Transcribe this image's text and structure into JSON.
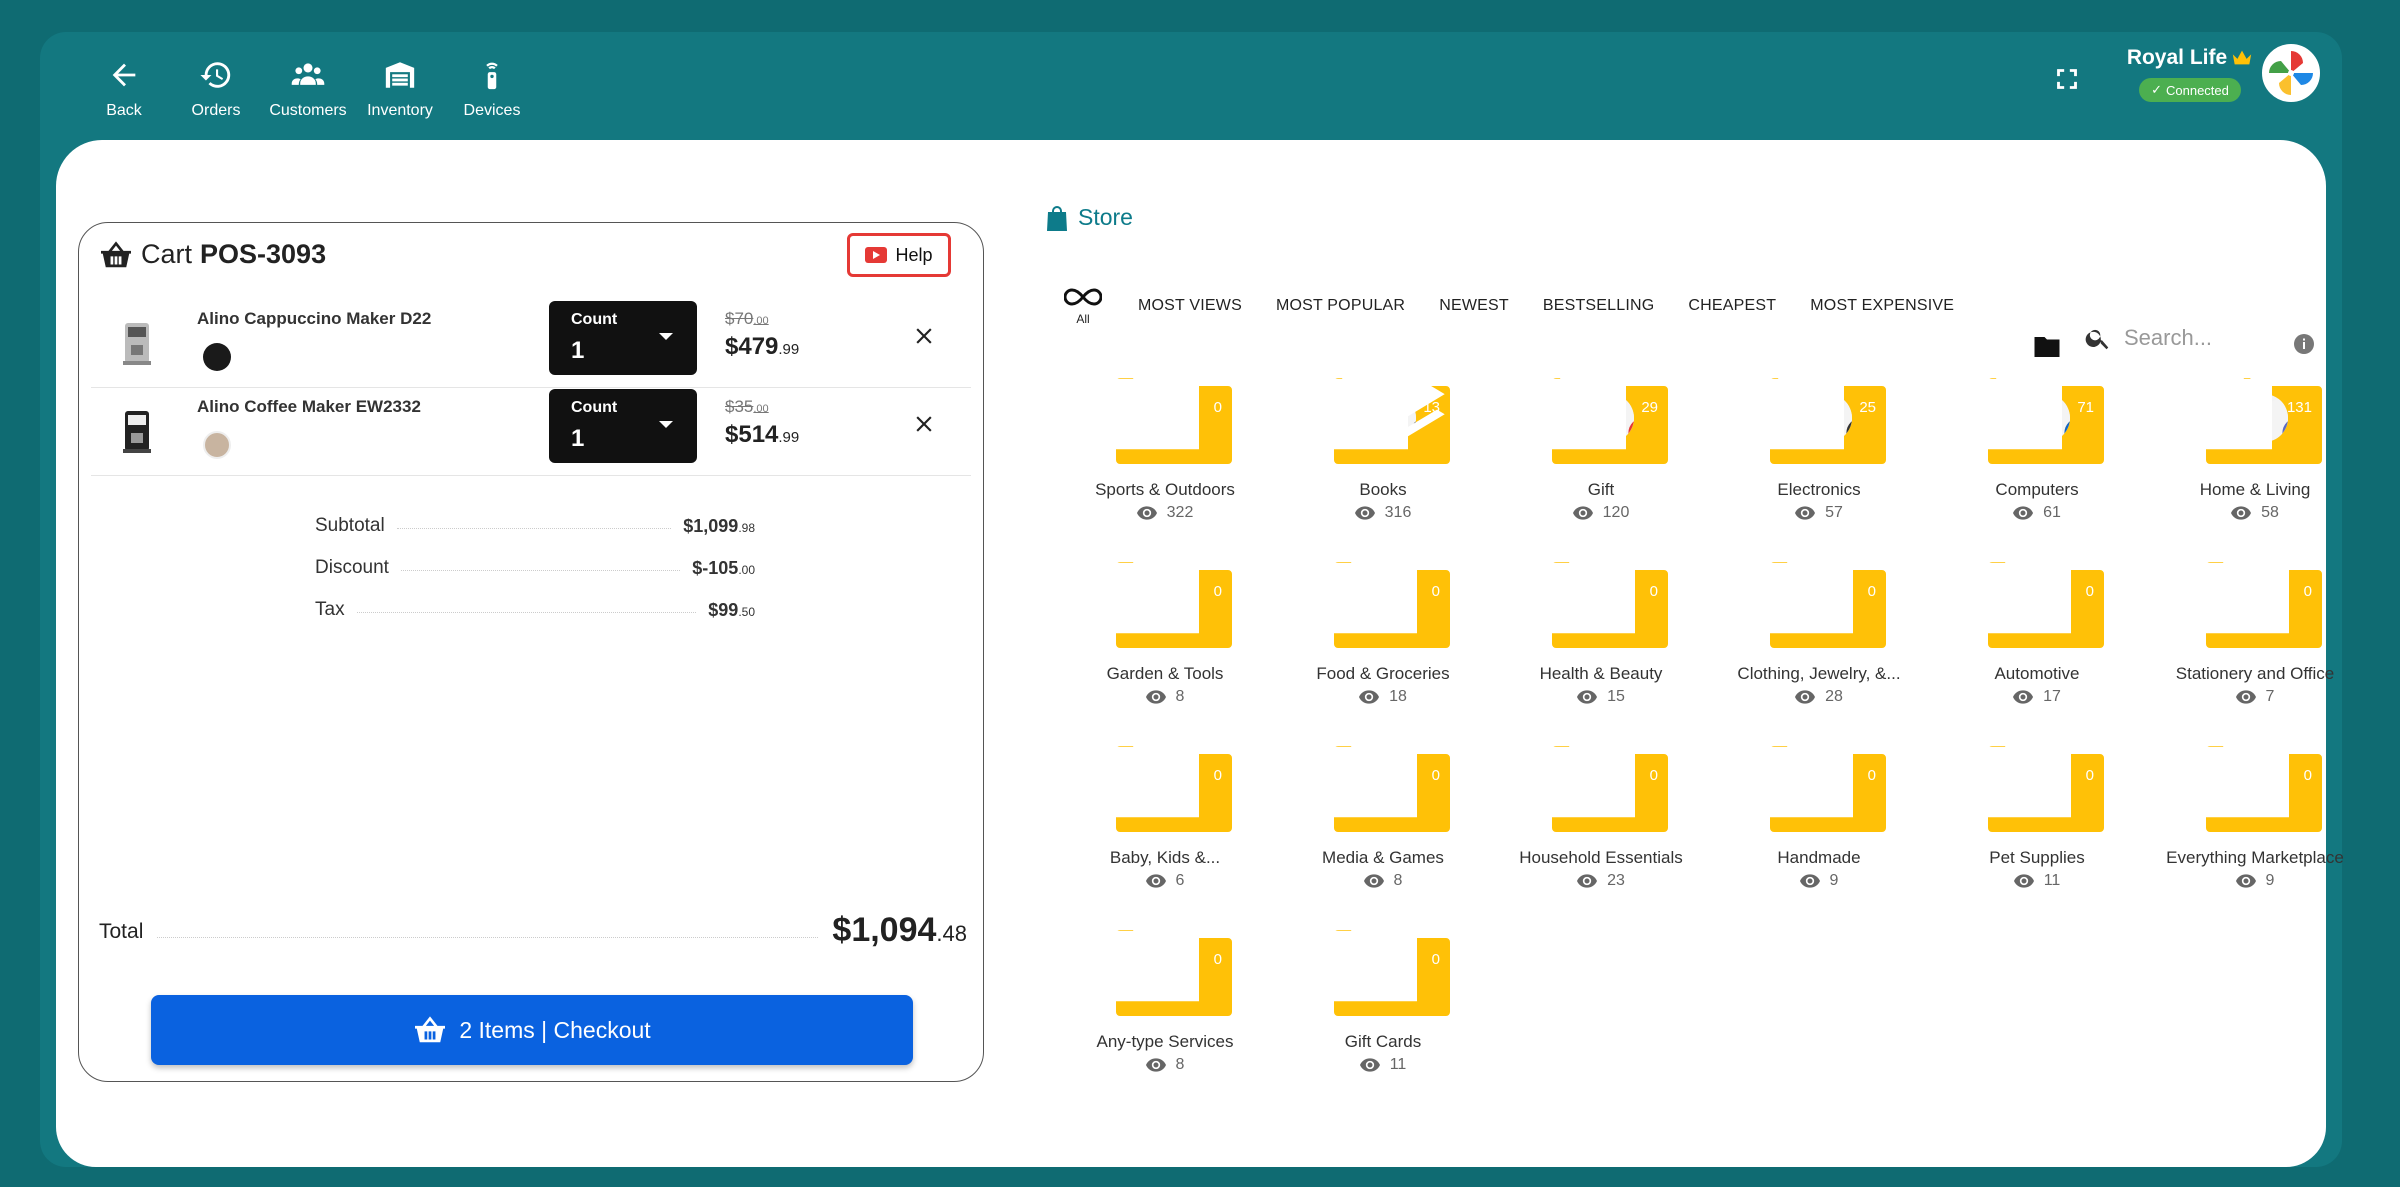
{
  "nav": [
    {
      "id": "back",
      "label": "Back",
      "icon": "arrow-back-icon"
    },
    {
      "id": "orders",
      "label": "Orders",
      "icon": "history-icon"
    },
    {
      "id": "customers",
      "label": "Customers",
      "icon": "people-icon"
    },
    {
      "id": "inventory",
      "label": "Inventory",
      "icon": "warehouse-icon"
    },
    {
      "id": "devices",
      "label": "Devices",
      "icon": "remote-device-icon"
    }
  ],
  "user": {
    "name": "Royal Life",
    "status": "Connected"
  },
  "cart": {
    "title": "Cart",
    "code": "POS-3093",
    "help_label": "Help",
    "items": [
      {
        "name": "Alino Cappuccino Maker D22",
        "swatch": "#1a1a1a",
        "count_label": "Count",
        "count": "1",
        "old_price": "$70",
        "old_cents": ".00",
        "price": "$479",
        "cents": ".99"
      },
      {
        "name": "Alino Coffee Maker EW2332",
        "swatch": "#c8b4a0",
        "count_label": "Count",
        "count": "1",
        "old_price": "$35",
        "old_cents": ".00",
        "price": "$514",
        "cents": ".99"
      }
    ],
    "summary": [
      {
        "label": "Subtotal",
        "value": "$1,099",
        "cents": ".98"
      },
      {
        "label": "Discount",
        "value": "$-105",
        "cents": ".00"
      },
      {
        "label": "Tax",
        "value": "$99",
        "cents": ".50"
      }
    ],
    "total_label": "Total",
    "total_value": "$1,094",
    "total_cents": ".48",
    "checkout_label": "2 Items | Checkout"
  },
  "store": {
    "title": "Store",
    "all_label": "All",
    "filters": [
      "MOST VIEWS",
      "MOST POPULAR",
      "NEWEST",
      "BESTSELLING",
      "CHEAPEST",
      "MOST EXPENSIVE"
    ],
    "search_placeholder": "Search...",
    "colors": {
      "folder": "#ffc107",
      "accent": "#0d7b8a"
    },
    "categories": [
      {
        "name": "Sports & Outdoors",
        "count": "0",
        "views": "322"
      },
      {
        "name": "Books",
        "count": "13",
        "views": "316",
        "layers": true
      },
      {
        "name": "Gift",
        "count": "29",
        "views": "120"
      },
      {
        "name": "Electronics",
        "count": "25",
        "views": "57"
      },
      {
        "name": "Computers",
        "count": "71",
        "views": "61"
      },
      {
        "name": "Home & Living",
        "count": "131",
        "views": "58"
      },
      {
        "name": "Garden & Tools",
        "count": "0",
        "views": "8"
      },
      {
        "name": "Food & Groceries",
        "count": "0",
        "views": "18"
      },
      {
        "name": "Health & Beauty",
        "count": "0",
        "views": "15"
      },
      {
        "name": "Clothing, Jewelry, &...",
        "count": "0",
        "views": "28"
      },
      {
        "name": "Automotive",
        "count": "0",
        "views": "17"
      },
      {
        "name": "Stationery and Office",
        "count": "0",
        "views": "7"
      },
      {
        "name": "Baby, Kids &...",
        "count": "0",
        "views": "6"
      },
      {
        "name": "Media & Games",
        "count": "0",
        "views": "8"
      },
      {
        "name": "Household Essentials",
        "count": "0",
        "views": "23"
      },
      {
        "name": "Handmade",
        "count": "0",
        "views": "9"
      },
      {
        "name": "Pet Supplies",
        "count": "0",
        "views": "11"
      },
      {
        "name": "Everything Marketplace",
        "count": "0",
        "views": "9"
      },
      {
        "name": "Any-type Services",
        "count": "0",
        "views": "8"
      },
      {
        "name": "Gift Cards",
        "count": "0",
        "views": "11"
      }
    ]
  }
}
